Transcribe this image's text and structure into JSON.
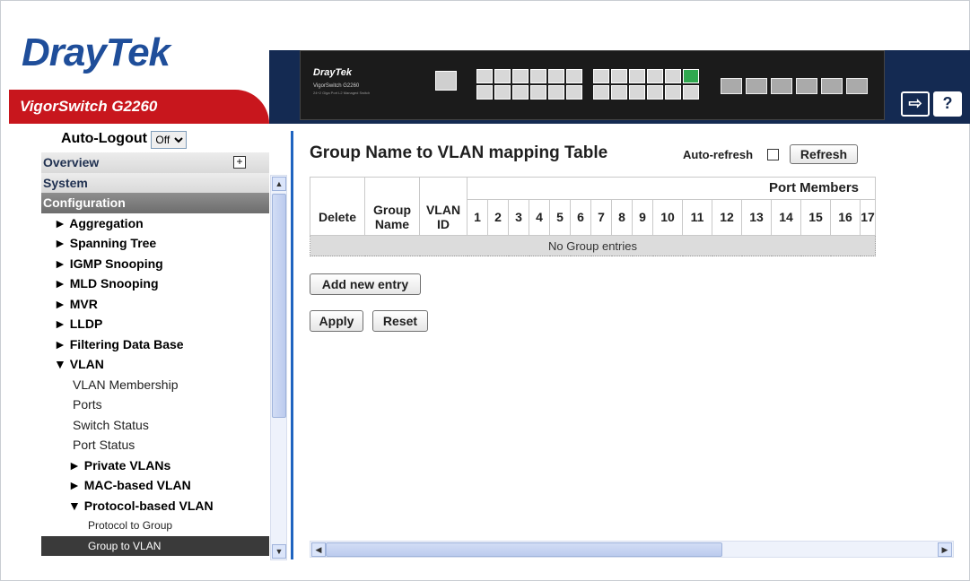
{
  "header": {
    "brand_dray": "Dray",
    "brand_tek": "Tek",
    "model": "VigorSwitch G2260",
    "device_brand": "DrayTek",
    "device_model": "VigorSwitch G2260",
    "device_sub": "24+2 Giga Port L2 Managed Switch",
    "logout_icon": "logout-icon",
    "help_label": "?"
  },
  "nav": {
    "autologout_label": "Auto-Logout",
    "autologout_value": "Off",
    "items": [
      {
        "label": "Overview",
        "level": "sec"
      },
      {
        "label": "System",
        "level": "sec"
      },
      {
        "label": "Configuration",
        "level": "sec-active"
      },
      {
        "label": "► Aggregation",
        "level": "l1"
      },
      {
        "label": "► Spanning Tree",
        "level": "l1"
      },
      {
        "label": "► IGMP Snooping",
        "level": "l1"
      },
      {
        "label": "► MLD Snooping",
        "level": "l1"
      },
      {
        "label": "► MVR",
        "level": "l1"
      },
      {
        "label": "► LLDP",
        "level": "l1"
      },
      {
        "label": "► Filtering Data Base",
        "level": "l1"
      },
      {
        "label": "▼ VLAN",
        "level": "l1"
      },
      {
        "label": "VLAN Membership",
        "level": "l2"
      },
      {
        "label": "Ports",
        "level": "l2"
      },
      {
        "label": "Switch Status",
        "level": "l2"
      },
      {
        "label": "Port Status",
        "level": "l2"
      },
      {
        "label": "► Private VLANs",
        "level": "l2b"
      },
      {
        "label": "► MAC-based VLAN",
        "level": "l2b"
      },
      {
        "label": "▼ Protocol-based VLAN",
        "level": "l2b"
      },
      {
        "label": "Protocol to Group",
        "level": "l3"
      },
      {
        "label": "Group to VLAN",
        "level": "l3-cur"
      }
    ]
  },
  "main": {
    "title": "Group Name to VLAN mapping Table",
    "autorefresh_label": "Auto-refresh",
    "refresh_label": "Refresh",
    "port_members_label": "Port Members",
    "columns": {
      "delete": "Delete",
      "group_name": "Group Name",
      "vlan_id": "VLAN ID"
    },
    "ports": [
      "1",
      "2",
      "3",
      "4",
      "5",
      "6",
      "7",
      "8",
      "9",
      "10",
      "11",
      "12",
      "13",
      "14",
      "15",
      "16",
      "17"
    ],
    "empty_text": "No Group entries",
    "add_label": "Add new entry",
    "apply_label": "Apply",
    "reset_label": "Reset"
  },
  "colors": {
    "brand_blue": "#1f4e9a",
    "brand_red": "#c8161d",
    "header_navy": "#142a52",
    "divider_blue": "#1f64c0"
  }
}
